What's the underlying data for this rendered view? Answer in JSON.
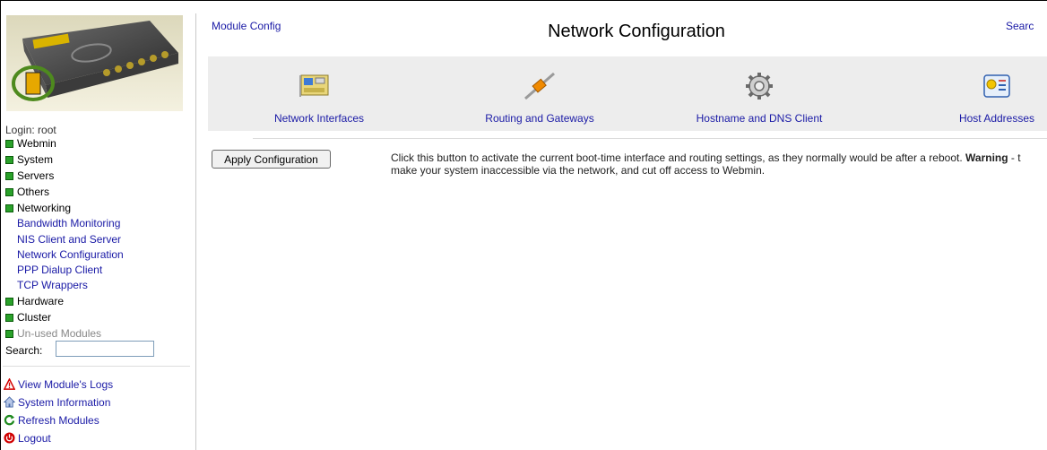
{
  "sidebar": {
    "login": "Login: root",
    "categories": [
      {
        "label": "Webmin"
      },
      {
        "label": "System"
      },
      {
        "label": "Servers"
      },
      {
        "label": "Others"
      },
      {
        "label": "Networking"
      },
      {
        "label": "Hardware"
      },
      {
        "label": "Cluster"
      },
      {
        "label": "Un-used Modules"
      }
    ],
    "networking_items": [
      {
        "label": "Bandwidth Monitoring"
      },
      {
        "label": "NIS Client and Server"
      },
      {
        "label": "Network Configuration"
      },
      {
        "label": "PPP Dialup Client"
      },
      {
        "label": "TCP Wrappers"
      }
    ],
    "search_label": "Search:",
    "search_value": "",
    "actions": [
      {
        "label": "View Module's Logs",
        "icon": "warning-icon"
      },
      {
        "label": "System Information",
        "icon": "home-icon"
      },
      {
        "label": "Refresh Modules",
        "icon": "refresh-icon"
      },
      {
        "label": "Logout",
        "icon": "power-icon"
      }
    ]
  },
  "header": {
    "module_config": "Module Config",
    "title": "Network Configuration",
    "search_link": "Searc"
  },
  "modules": [
    {
      "label": "Network Interfaces",
      "icon": "network-card-icon"
    },
    {
      "label": "Routing and Gateways",
      "icon": "cable-icon"
    },
    {
      "label": "Hostname and DNS Client",
      "icon": "gear-icon"
    },
    {
      "label": "Host Addresses",
      "icon": "address-card-icon"
    }
  ],
  "apply": {
    "button_label": "Apply Configuration",
    "desc_pre": "Click this button to activate the current boot-time interface and routing settings, as they normally would be after a reboot. ",
    "desc_warning": "Warning",
    "desc_post": " - t",
    "desc_line2": "make your system inaccessible via the network, and cut off access to Webmin."
  },
  "colors": {
    "link": "#1a1aa6",
    "category_box": "#2aa12a",
    "panel_bg": "#ededed"
  }
}
